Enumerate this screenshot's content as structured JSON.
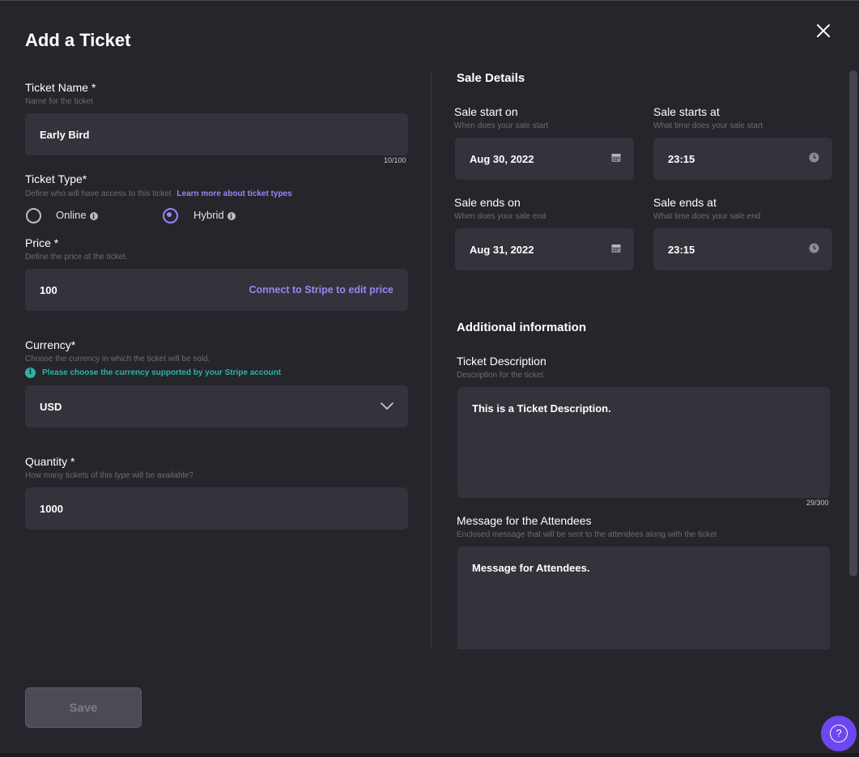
{
  "modal": {
    "title": "Add a Ticket"
  },
  "ticket_name": {
    "label": "Ticket Name *",
    "hint": "Name for the ticket",
    "value": "Early Bird",
    "counter": "10/100"
  },
  "ticket_type": {
    "label": "Ticket Type*",
    "hint": "Define who will have access to this ticket",
    "link": "Learn more about ticket types",
    "options": [
      {
        "label": "Online",
        "selected": false
      },
      {
        "label": "Hybrid",
        "selected": true
      }
    ]
  },
  "price": {
    "label": "Price *",
    "hint": "Define the price of the ticket.",
    "value": "100",
    "action": "Connect to Stripe to edit price"
  },
  "currency": {
    "label": "Currency*",
    "hint": "Choose the currency in which the ticket will be sold.",
    "note": "Please choose the currency supported by your Stripe account",
    "value": "USD"
  },
  "quantity": {
    "label": "Quantity *",
    "hint": "How many tickets of this type will be available?",
    "value": "1000"
  },
  "sale_details": {
    "title": "Sale Details",
    "start_date": {
      "label": "Sale start on",
      "hint": "When does your sale start",
      "value": "Aug 30, 2022"
    },
    "start_time": {
      "label": "Sale starts at",
      "hint": "What time does your sale start",
      "value": "23:15"
    },
    "end_date": {
      "label": "Sale ends on",
      "hint": "When does your sale end",
      "value": "Aug 31, 2022"
    },
    "end_time": {
      "label": "Sale ends at",
      "hint": "What time does your sale end",
      "value": "23:15"
    }
  },
  "additional": {
    "title": "Additional information",
    "description": {
      "label": "Ticket Description",
      "hint": "Description for the ticket",
      "value": "This is a Ticket Description.",
      "counter": "29/300"
    },
    "message": {
      "label": "Message for the Attendees",
      "hint": "Enclosed message that will be sent to the attendees along with the ticket",
      "value": "Message for Attendees."
    }
  },
  "footer": {
    "save_label": "Save",
    "help_label": "?"
  },
  "colors": {
    "background": "#26252c",
    "field": "#34333b",
    "accent": "#9b84f2",
    "teal": "#2bb3a8",
    "help_button": "#6d48f0"
  }
}
